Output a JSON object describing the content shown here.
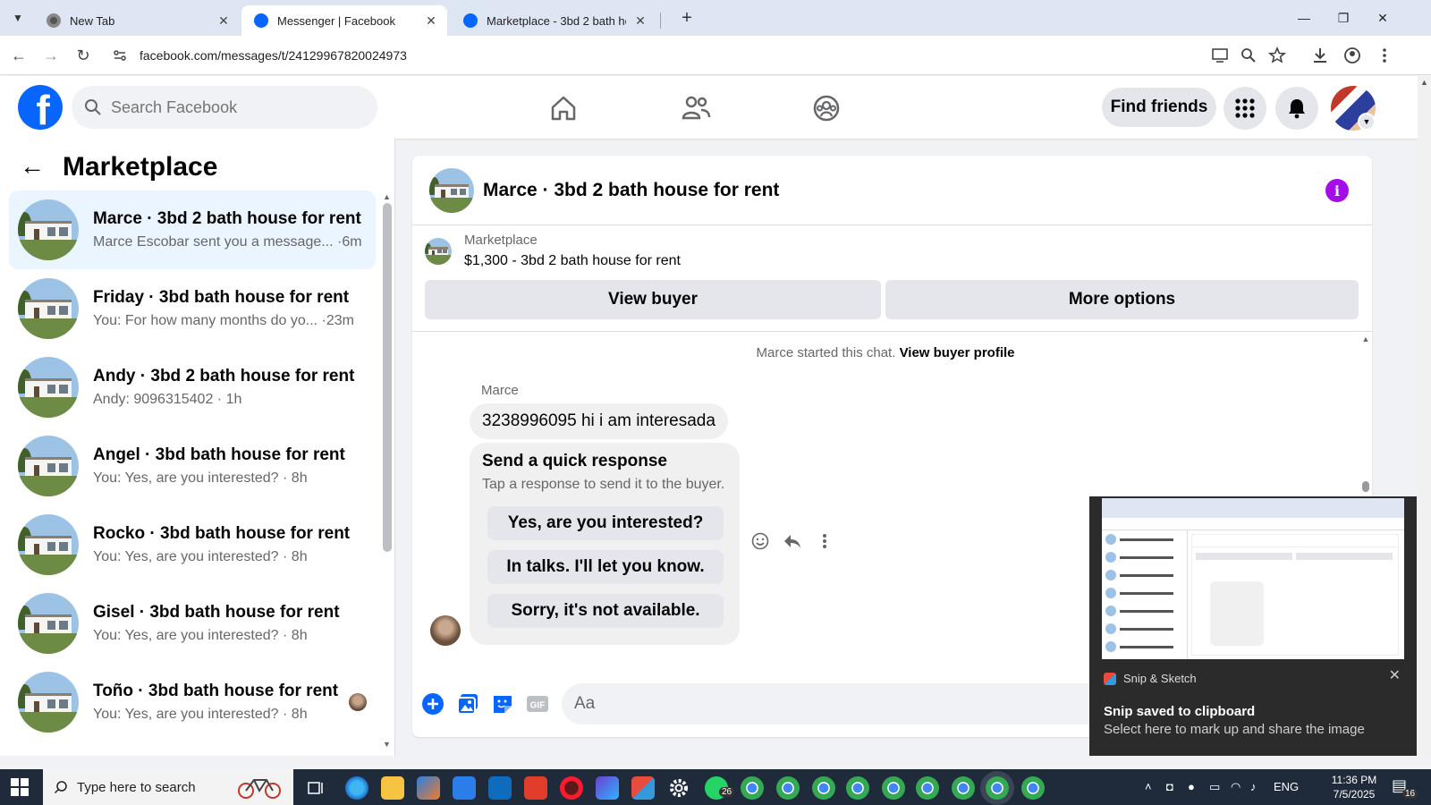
{
  "browser": {
    "tabs": [
      {
        "title": "New Tab",
        "active": false
      },
      {
        "title": "Messenger | Facebook",
        "active": true
      },
      {
        "title": "Marketplace - 3bd 2 bath hous",
        "active": false
      }
    ],
    "url": "facebook.com/messages/t/24129967820024973"
  },
  "header": {
    "search_placeholder": "Search Facebook",
    "find_friends": "Find friends"
  },
  "sidebar": {
    "title": "Marketplace",
    "conversations": [
      {
        "title": "Marce · 3bd 2 bath house for rent",
        "subtitle": "Marce Escobar sent you a message... ·6m",
        "active": true
      },
      {
        "title": "Friday · 3bd bath house for rent",
        "subtitle": "You: For how many months do yo... ·23m",
        "active": false
      },
      {
        "title": "Andy · 3bd 2 bath house for rent",
        "subtitle": "Andy: 9096315402 · 1h",
        "active": false
      },
      {
        "title": "Angel · 3bd bath house for rent",
        "subtitle": "You: Yes, are you interested? · 8h",
        "active": false
      },
      {
        "title": "Rocko · 3bd bath house for rent",
        "subtitle": "You: Yes, are you interested? · 8h",
        "active": false
      },
      {
        "title": "Gisel · 3bd bath house for rent",
        "subtitle": "You: Yes, are you interested? · 8h",
        "active": false
      },
      {
        "title": "Toño · 3bd bath house for rent",
        "subtitle": "You: Yes, are you interested? · 8h",
        "active": false
      }
    ]
  },
  "chat": {
    "title": "Marce · 3bd 2 bath house for rent",
    "listing_label": "Marketplace",
    "listing_desc": "$1,300 - 3bd 2 bath house for rent",
    "view_buyer": "View buyer",
    "more_options": "More options",
    "started_text": "Marce started this chat.",
    "started_link": "View buyer profile",
    "sender": "Marce",
    "message": "3238996095 hi i am interesada",
    "quick_title": "Send a quick response",
    "quick_sub": "Tap a response to send it to the buyer.",
    "quick_responses": [
      "Yes, are you interested?",
      "In talks. I'll let you know.",
      "Sorry, it's not available."
    ],
    "composer_placeholder": "Aa"
  },
  "toast": {
    "app": "Snip & Sketch",
    "title": "Snip saved to clipboard",
    "subtitle": "Select here to mark up and share the image"
  },
  "taskbar": {
    "search": "Type here to search",
    "whatsapp_badge": "26",
    "lang": "ENG",
    "time": "11:36 PM",
    "date": "7/5/2025",
    "notif_count": "16"
  },
  "colors": {
    "fb_blue": "#0866ff",
    "info_purple": "#a40ce8"
  }
}
